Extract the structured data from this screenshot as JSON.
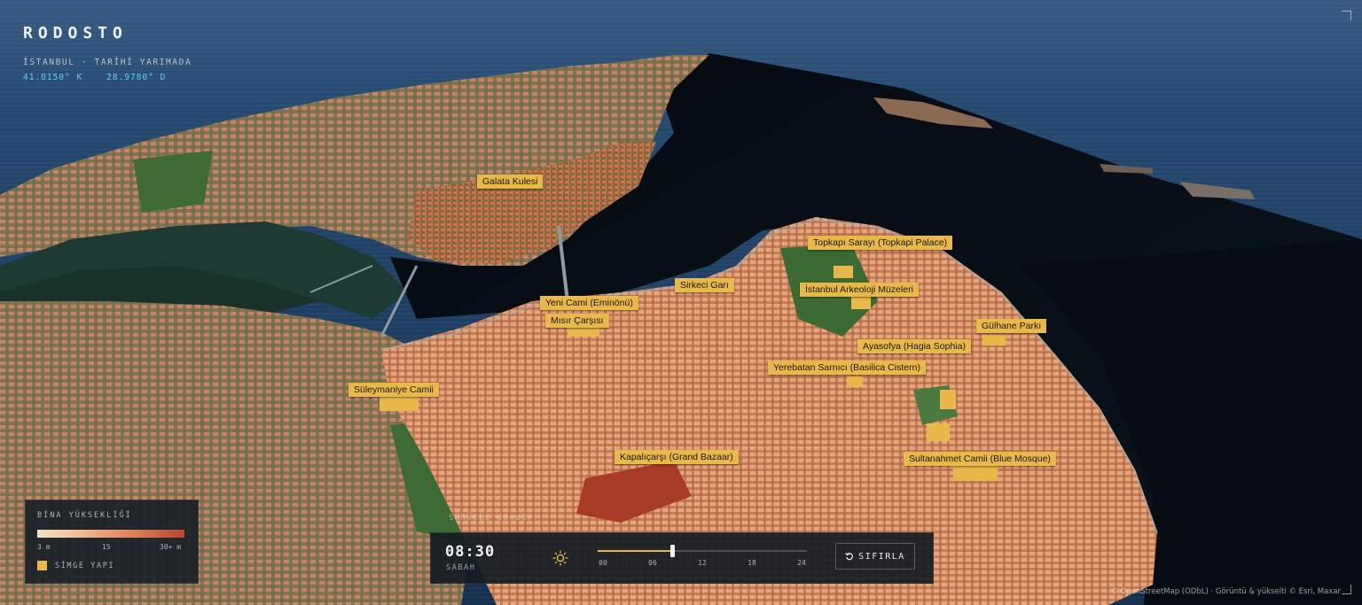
{
  "header": {
    "title": "RODOSTO",
    "subtitle": "İSTANBUL · TARİHİ YARIMADA",
    "lat": "41.0150° K",
    "lon": "28.9780° D"
  },
  "landmarks": [
    {
      "name": "Galata Kulesi"
    },
    {
      "name": "Topkapı Sarayı (Topkapi Palace)"
    },
    {
      "name": "Sirkeci Garı"
    },
    {
      "name": "İstanbul Arkeoloji Müzeleri"
    },
    {
      "name": "Yeni Cami (Eminönü)"
    },
    {
      "name": "Mısır Çarşısı"
    },
    {
      "name": "Gülhane Parkı"
    },
    {
      "name": "Ayasofya (Hagia Sophia)"
    },
    {
      "name": "Yerebatan Sarnıcı (Basilica Cistern)"
    },
    {
      "name": "Süleymaniye Camii"
    },
    {
      "name": "Kapalıçarşı (Grand Bazaar)"
    },
    {
      "name": "Sultanahmet Camii (Blue Mosque)"
    }
  ],
  "legend": {
    "title": "BİNA YÜKSEKLİĞİ",
    "ticks": [
      "3 m",
      "15",
      "30+ m"
    ],
    "landmark_label": "SİMGE YAPI",
    "landmark_color": "#e9b84a",
    "gradient": [
      "#f5e3c9",
      "#efb58c",
      "#dc7f55",
      "#b8452e"
    ]
  },
  "hint": "SÜRÜKLE döndür",
  "time": {
    "value": "08:30",
    "period": "SABAH",
    "slider_hour": 8.5,
    "slider_max": 24,
    "ticks": [
      "00",
      "06",
      "12",
      "18",
      "24"
    ],
    "reset_label": "SIFIRLA",
    "accent": "#e9b84a"
  },
  "attribution": "© OpenStreetMap (ODbL) · Görüntü & yükselti © Esri, Maxar",
  "icons": {
    "sun": "sun-icon",
    "reset": "rotate-ccw-icon"
  }
}
